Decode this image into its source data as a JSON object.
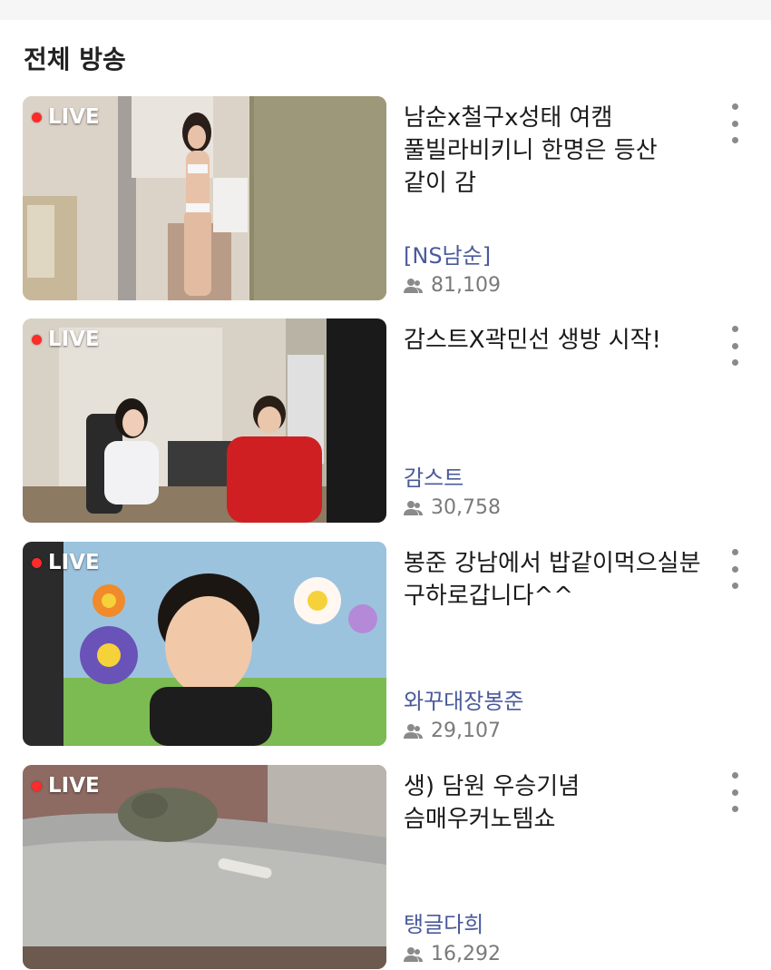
{
  "section": {
    "title": "전체 방송"
  },
  "live_label": "LIVE",
  "streams": [
    {
      "title": "남순x철구x성태  여캠 풀빌라비키니 한명은  등산 같이 감",
      "channel": "[NS남순]",
      "viewers": "81,109"
    },
    {
      "title": "감스트X곽민선 생방 시작!",
      "channel": "감스트",
      "viewers": "30,758"
    },
    {
      "title": "봉준 강남에서 밥같이먹으실분 구하로갑니다^^",
      "channel": "와꾸대장봉준",
      "viewers": "29,107"
    },
    {
      "title": "생) 담원 우승기념 슴매우커노템쇼",
      "channel": "탱글다희",
      "viewers": "16,292"
    }
  ],
  "colors": {
    "live_dot": "#ff2a2a",
    "channel": "#4a5a9a",
    "viewers": "#7a7a7a"
  },
  "icons": {
    "viewers": "people-icon",
    "more": "more-vertical-icon"
  }
}
